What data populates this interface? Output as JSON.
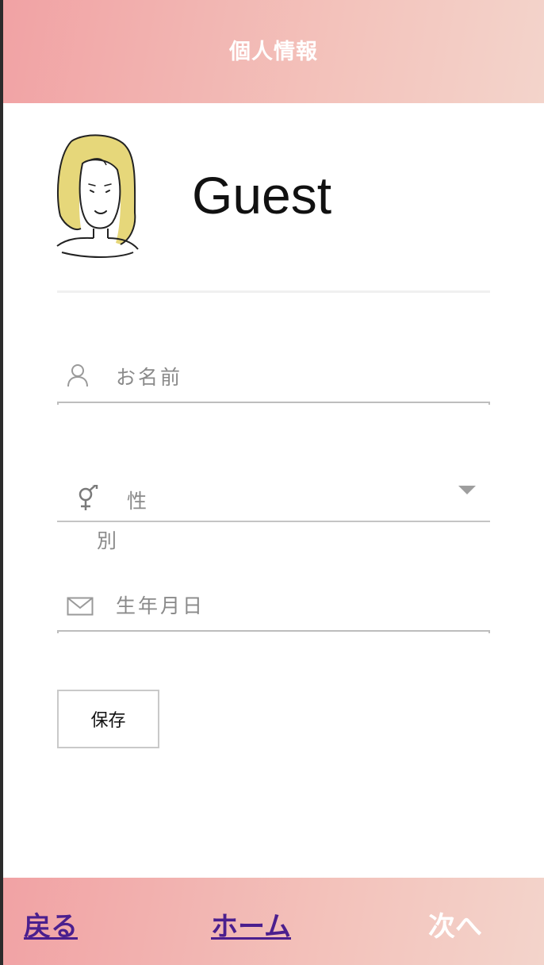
{
  "header": {
    "title": "個人情報"
  },
  "profile": {
    "username": "Guest"
  },
  "form": {
    "name_placeholder": "お名前",
    "gender_placeholder_line1": "性",
    "gender_placeholder_line2": "別",
    "birth_placeholder": "生年月日",
    "save_label": "保存"
  },
  "footer": {
    "back_label": "戻る",
    "home_label": "ホーム",
    "next_label": "次へ"
  },
  "icons": {
    "name": "person-icon",
    "gender": "gender-icon",
    "birth": "envelope-icon",
    "dropdown": "caret-down-icon",
    "avatar": "avatar-illustration"
  },
  "colors": {
    "header_gradient_start": "#f1a2a4",
    "header_gradient_end": "#f3d4cb",
    "link_color": "#4b1f8e",
    "hair_color": "#e6d77a"
  }
}
